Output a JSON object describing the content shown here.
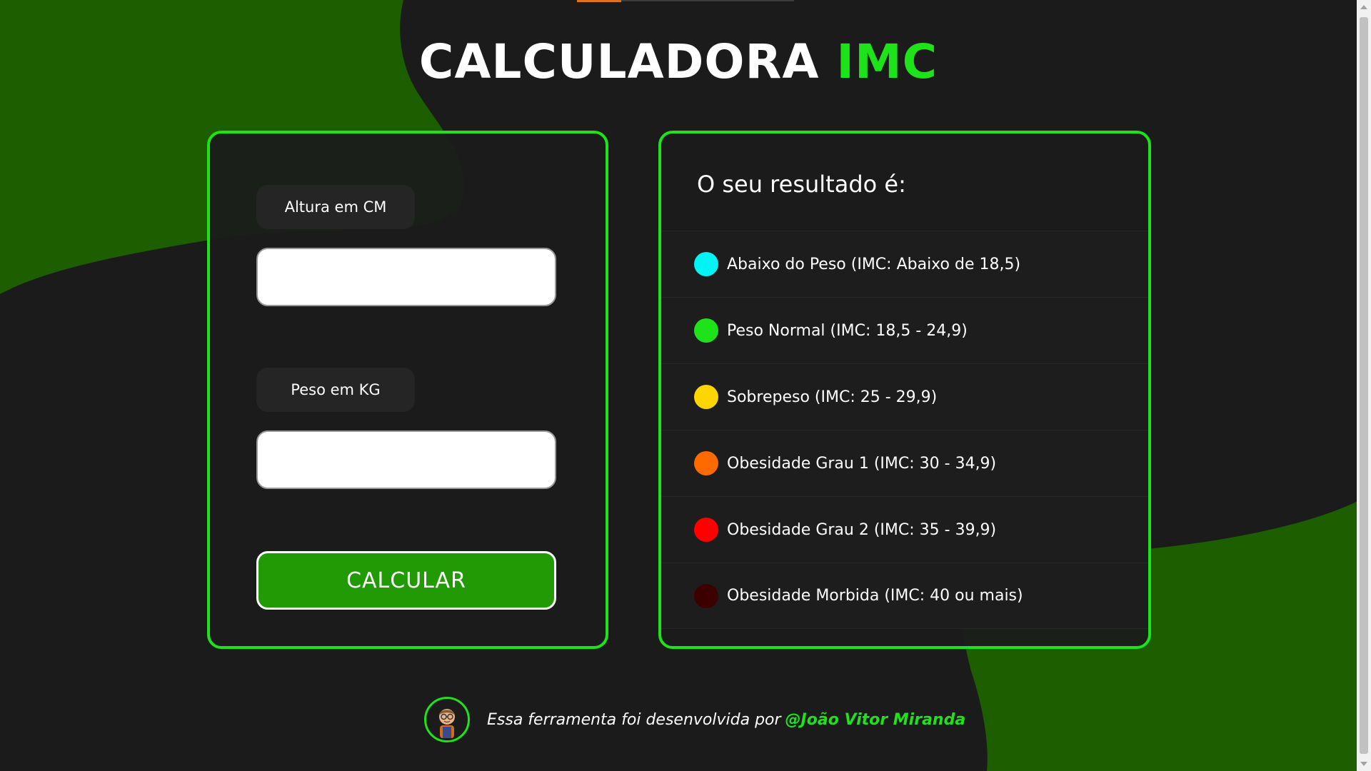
{
  "header": {
    "title_main": "CALCULADORA",
    "title_accent": "IMC"
  },
  "form": {
    "height_label": "Altura em CM",
    "height_value": "",
    "weight_label": "Peso em KG",
    "weight_value": "",
    "calculate_label": "CALCULAR"
  },
  "results": {
    "title": "O seu resultado é:",
    "items": [
      {
        "label": "Abaixo do Peso (IMC: Abaixo de 18,5)",
        "color": "#00f4f4"
      },
      {
        "label": "Peso Normal (IMC: 18,5 - 24,9)",
        "color": "#1ee21a"
      },
      {
        "label": "Sobrepeso (IMC: 25 - 29,9)",
        "color": "#ffd500"
      },
      {
        "label": "Obesidade Grau 1 (IMC: 30 - 34,9)",
        "color": "#ff6a00"
      },
      {
        "label": "Obesidade Grau 2 (IMC: 35 - 39,9)",
        "color": "#ff0000"
      },
      {
        "label": "Obesidade Morbida (IMC: 40 ou mais)",
        "color": "#3d0000"
      }
    ]
  },
  "footer": {
    "text": "Essa ferramenta foi desenvolvida por",
    "author_link": "@João Vitor Miranda"
  },
  "colors": {
    "accent": "#1ee21a",
    "background": "#1b1b1b",
    "blob": "#1c5e00",
    "button": "#229a05"
  }
}
